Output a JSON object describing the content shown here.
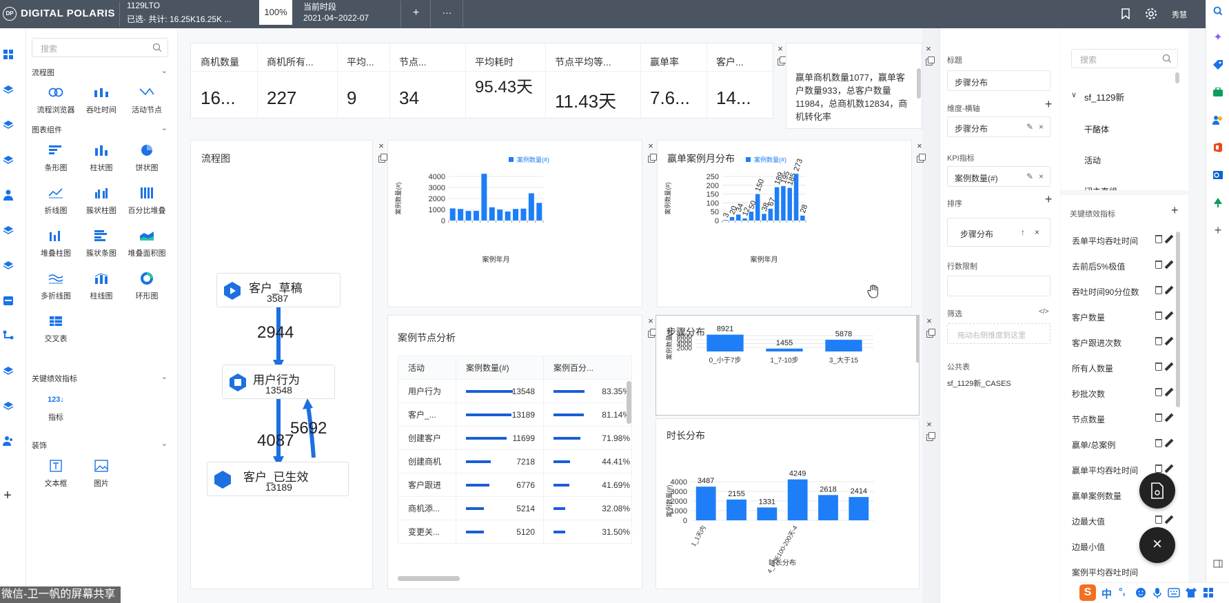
{
  "topbar": {
    "logo": "DIGITAL POLARIS",
    "logo_badge": "DP",
    "project_name": "1129LTO",
    "selection": "已选· 共计: 16.25K16.25K ...",
    "zoom": "100%",
    "period_label": "当前时段",
    "period_value": "2021-04~2022-07",
    "add": "+",
    "more": "···",
    "user": "秀慧"
  },
  "left_panel": {
    "search_placeholder": "搜索",
    "sections": {
      "flow": "流程图",
      "chart": "图表组件",
      "kpi": "关键绩效指标",
      "decor": "装饰"
    },
    "flow_items": [
      "流程浏览器",
      "吞吐时间",
      "活动节点"
    ],
    "chart_items": [
      "条形图",
      "柱状图",
      "饼状图",
      "折线图",
      "簇状柱图",
      "百分比堆叠",
      "堆叠柱图",
      "簇状条图",
      "堆叠面积图",
      "多折线图",
      "柱线图",
      "环形图",
      "交叉表"
    ],
    "kpi_items": [
      "指标"
    ],
    "decor_items": [
      "文本框",
      "图片"
    ]
  },
  "kpis": [
    {
      "label": "商机数量",
      "value": "16..."
    },
    {
      "label": "商机所有...",
      "value": "227"
    },
    {
      "label": "平均...",
      "value": "9"
    },
    {
      "label": "节点...",
      "value": "34"
    },
    {
      "label": "平均耗时",
      "value": "95.43天"
    },
    {
      "label": "节点平均等...",
      "value": "11.43天"
    },
    {
      "label": "赢单率",
      "value": "7.6..."
    },
    {
      "label": "客户...",
      "value": "14..."
    }
  ],
  "textbox": "赢单商机数量1077，赢单客户数量933，总客户数量11984，总商机数12834，商机转化率",
  "flow_card": {
    "title": "流程图",
    "nodes": [
      {
        "name": "客户_草稿",
        "count": "3587"
      },
      {
        "name": "用户行为",
        "count": "13548"
      },
      {
        "name": "客户_已生效",
        "count": "13189"
      }
    ],
    "edges": [
      "2944",
      "4087",
      "5692"
    ]
  },
  "chart_data": [
    {
      "type": "bar",
      "title": "",
      "legend": "案例数量(#)",
      "legend_position": "top-right",
      "xlabel": "案例年月",
      "ylabel": "案例数量(#)",
      "ylim": [
        0,
        4000
      ],
      "yticks": [
        "4000",
        "3000",
        "2000",
        "1000",
        "0"
      ],
      "values": [
        1100,
        1050,
        870,
        880,
        4250,
        1200,
        1000,
        820,
        1050,
        1080,
        2470,
        1600
      ]
    },
    {
      "type": "bar",
      "title": "赢单案例月分布",
      "legend": "案例数量(#)",
      "legend_position": "top-right",
      "xlabel": "案例年月",
      "ylabel": "案例数量(#)",
      "ylim": [
        0,
        250
      ],
      "yticks": [
        "250",
        "200",
        "150",
        "100",
        "50",
        "0"
      ],
      "values": [
        3,
        20,
        34,
        12,
        50,
        150,
        38,
        67,
        189,
        195,
        185,
        273,
        28
      ]
    },
    {
      "type": "bar",
      "title": "步骤分布",
      "xlabel": "",
      "ylabel": "案例数量(#)",
      "ylim": [
        0,
        8000
      ],
      "yticks": [
        "8000",
        "6000",
        "4000",
        "2000"
      ],
      "categories": [
        "0_小于7步",
        "1_7-10步",
        "3_大于15"
      ],
      "values": [
        8921,
        1455,
        5878
      ]
    },
    {
      "type": "bar",
      "title": "时长分布",
      "xlabel": "时长分布",
      "ylabel": "案例数量(#)",
      "ylim": [
        0,
        4000
      ],
      "yticks": [
        "4000",
        "3000",
        "2000",
        "1000",
        "0"
      ],
      "categories": [
        "1_1天内",
        "",
        "",
        "4_时长100-200天-4",
        "",
        ""
      ],
      "values": [
        3487,
        2155,
        1331,
        4249,
        2618,
        2414
      ]
    }
  ],
  "node_table": {
    "title": "案例节点分析",
    "columns": [
      "活动",
      "案例数量(#)",
      "案例百分..."
    ],
    "rows": [
      {
        "activity": "用户行为",
        "count": "13548",
        "pct": "83.35%",
        "count_frac": 1.0,
        "pct_frac": 0.8335
      },
      {
        "activity": "客户_...",
        "count": "13189",
        "pct": "81.14%",
        "count_frac": 0.973,
        "pct_frac": 0.8114
      },
      {
        "activity": "创建客户",
        "count": "11699",
        "pct": "71.98%",
        "count_frac": 0.864,
        "pct_frac": 0.7198
      },
      {
        "activity": "创建商机",
        "count": "7218",
        "pct": "44.41%",
        "count_frac": 0.533,
        "pct_frac": 0.4441
      },
      {
        "activity": "客户跟进",
        "count": "6776",
        "pct": "41.69%",
        "count_frac": 0.5,
        "pct_frac": 0.4169
      },
      {
        "activity": "商机添...",
        "count": "5214",
        "pct": "32.08%",
        "count_frac": 0.385,
        "pct_frac": 0.3208
      },
      {
        "activity": "变更关...",
        "count": "5120",
        "pct": "31.50%",
        "count_frac": 0.378,
        "pct_frac": 0.315
      }
    ]
  },
  "config": {
    "title_label": "标题",
    "title_value": "步骤分布",
    "dim_label": "维度-横轴",
    "dim_value": "步骤分布",
    "kpi_label": "KPI指标",
    "kpi_value": "案例数量(#)",
    "sort_label": "排序",
    "sort_value": "步骤分布",
    "limit_label": "行数限制",
    "filter_label": "筛选",
    "filter_code": "</>",
    "filter_placeholder": "拖动右侧维度到这里",
    "table_label": "公共表",
    "table_value": "sf_1129新_CASES"
  },
  "right_panel": {
    "search_placeholder": "搜索",
    "tree_root": "sf_1129新",
    "tree_items": [
      "干酪体",
      "活动",
      "闭主直组"
    ],
    "kpi_header": "关键绩效指标",
    "kpis": [
      "丢单平均吞吐时间",
      "去前后5%极值",
      "吞吐时间90分位数",
      "客户数量",
      "客户跟进次数",
      "所有人数量",
      "秒批次数",
      "节点数量",
      "赢单/总案例",
      "赢单平均吞吐时间",
      "赢单案例数量",
      "边最大值",
      "边最小值",
      "案例平均吞吐时间"
    ]
  },
  "share_label": "微信-卫一帆的屏幕共享",
  "ime": {
    "brand": "S",
    "lang": "中",
    "punct": "°,"
  },
  "colors": {
    "accent": "#1a73e8",
    "bar": "#1e7ef7",
    "topbar": "#4b5562"
  }
}
